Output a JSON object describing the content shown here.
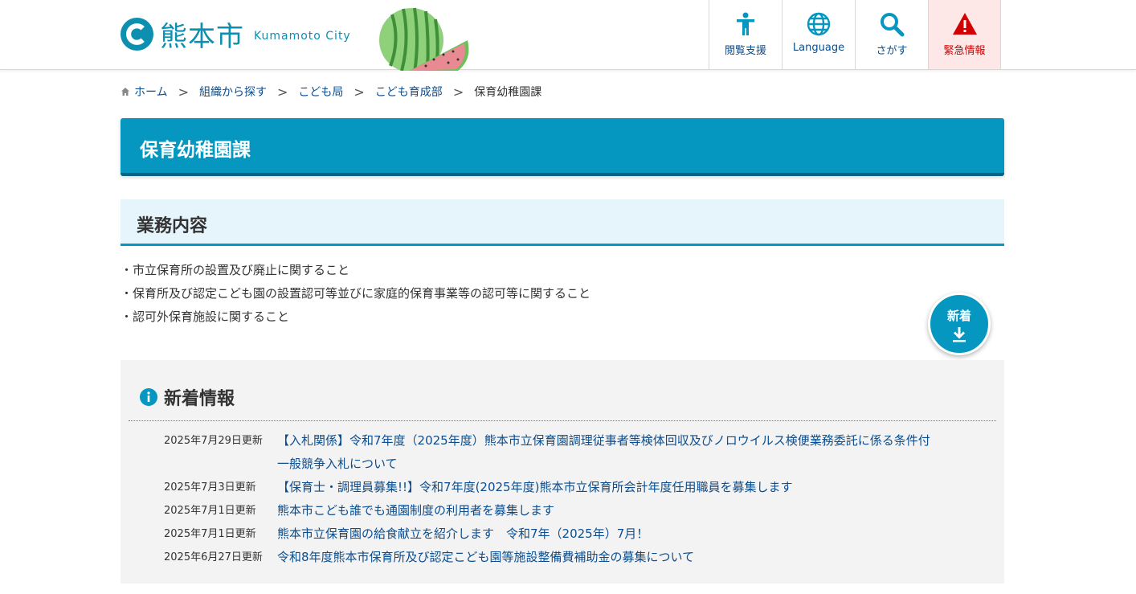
{
  "header": {
    "logo_text": "熊本市",
    "logo_sub": "Kumamoto City",
    "tools": [
      {
        "label": "閲覧支援",
        "icon": "accessibility-icon"
      },
      {
        "label": "Language",
        "icon": "globe-icon"
      },
      {
        "label": "さがす",
        "icon": "search-icon"
      },
      {
        "label": "緊急情報",
        "icon": "warning-icon"
      }
    ],
    "colors": {
      "brand": "#0d8fb0",
      "link": "#0b4d8e",
      "emergency": "#d20000"
    }
  },
  "breadcrumb": {
    "items": [
      "ホーム",
      "組織から探す",
      "こども局",
      "こども育成部"
    ],
    "current": "保育幼稚園課"
  },
  "page": {
    "title": "保育幼稚園課",
    "section_heading": "業務内容",
    "duties": [
      "・市立保育所の設置及び廃止に関すること",
      "・保育所及び認定こども園の設置認可等並びに家庭的保育事業等の認可等に関すること",
      "・認可外保育施設に関すること"
    ]
  },
  "new_button": {
    "label": "新着"
  },
  "news": {
    "heading": "新着情報",
    "items": [
      {
        "date": "2025年7月29日更新",
        "title": "【入札関係】令和7年度（2025年度）熊本市立保育園調理従事者等検体回収及びノロウイルス検便業務委託に係る条件付一般競争入札について"
      },
      {
        "date": "2025年7月3日更新",
        "title": "【保育士・調理員募集!!】令和7年度(2025年度)熊本市立保育所会計年度任用職員を募集します"
      },
      {
        "date": "2025年7月1日更新",
        "title": "熊本市こども誰でも通園制度の利用者を募集します"
      },
      {
        "date": "2025年7月1日更新",
        "title": "熊本市立保育園の給食献立を紹介します　令和7年（2025年）7月！"
      },
      {
        "date": "2025年6月27日更新",
        "title": "令和8年度熊本市保育所及び認定こども園等施設整備費補助金の募集について"
      }
    ]
  }
}
